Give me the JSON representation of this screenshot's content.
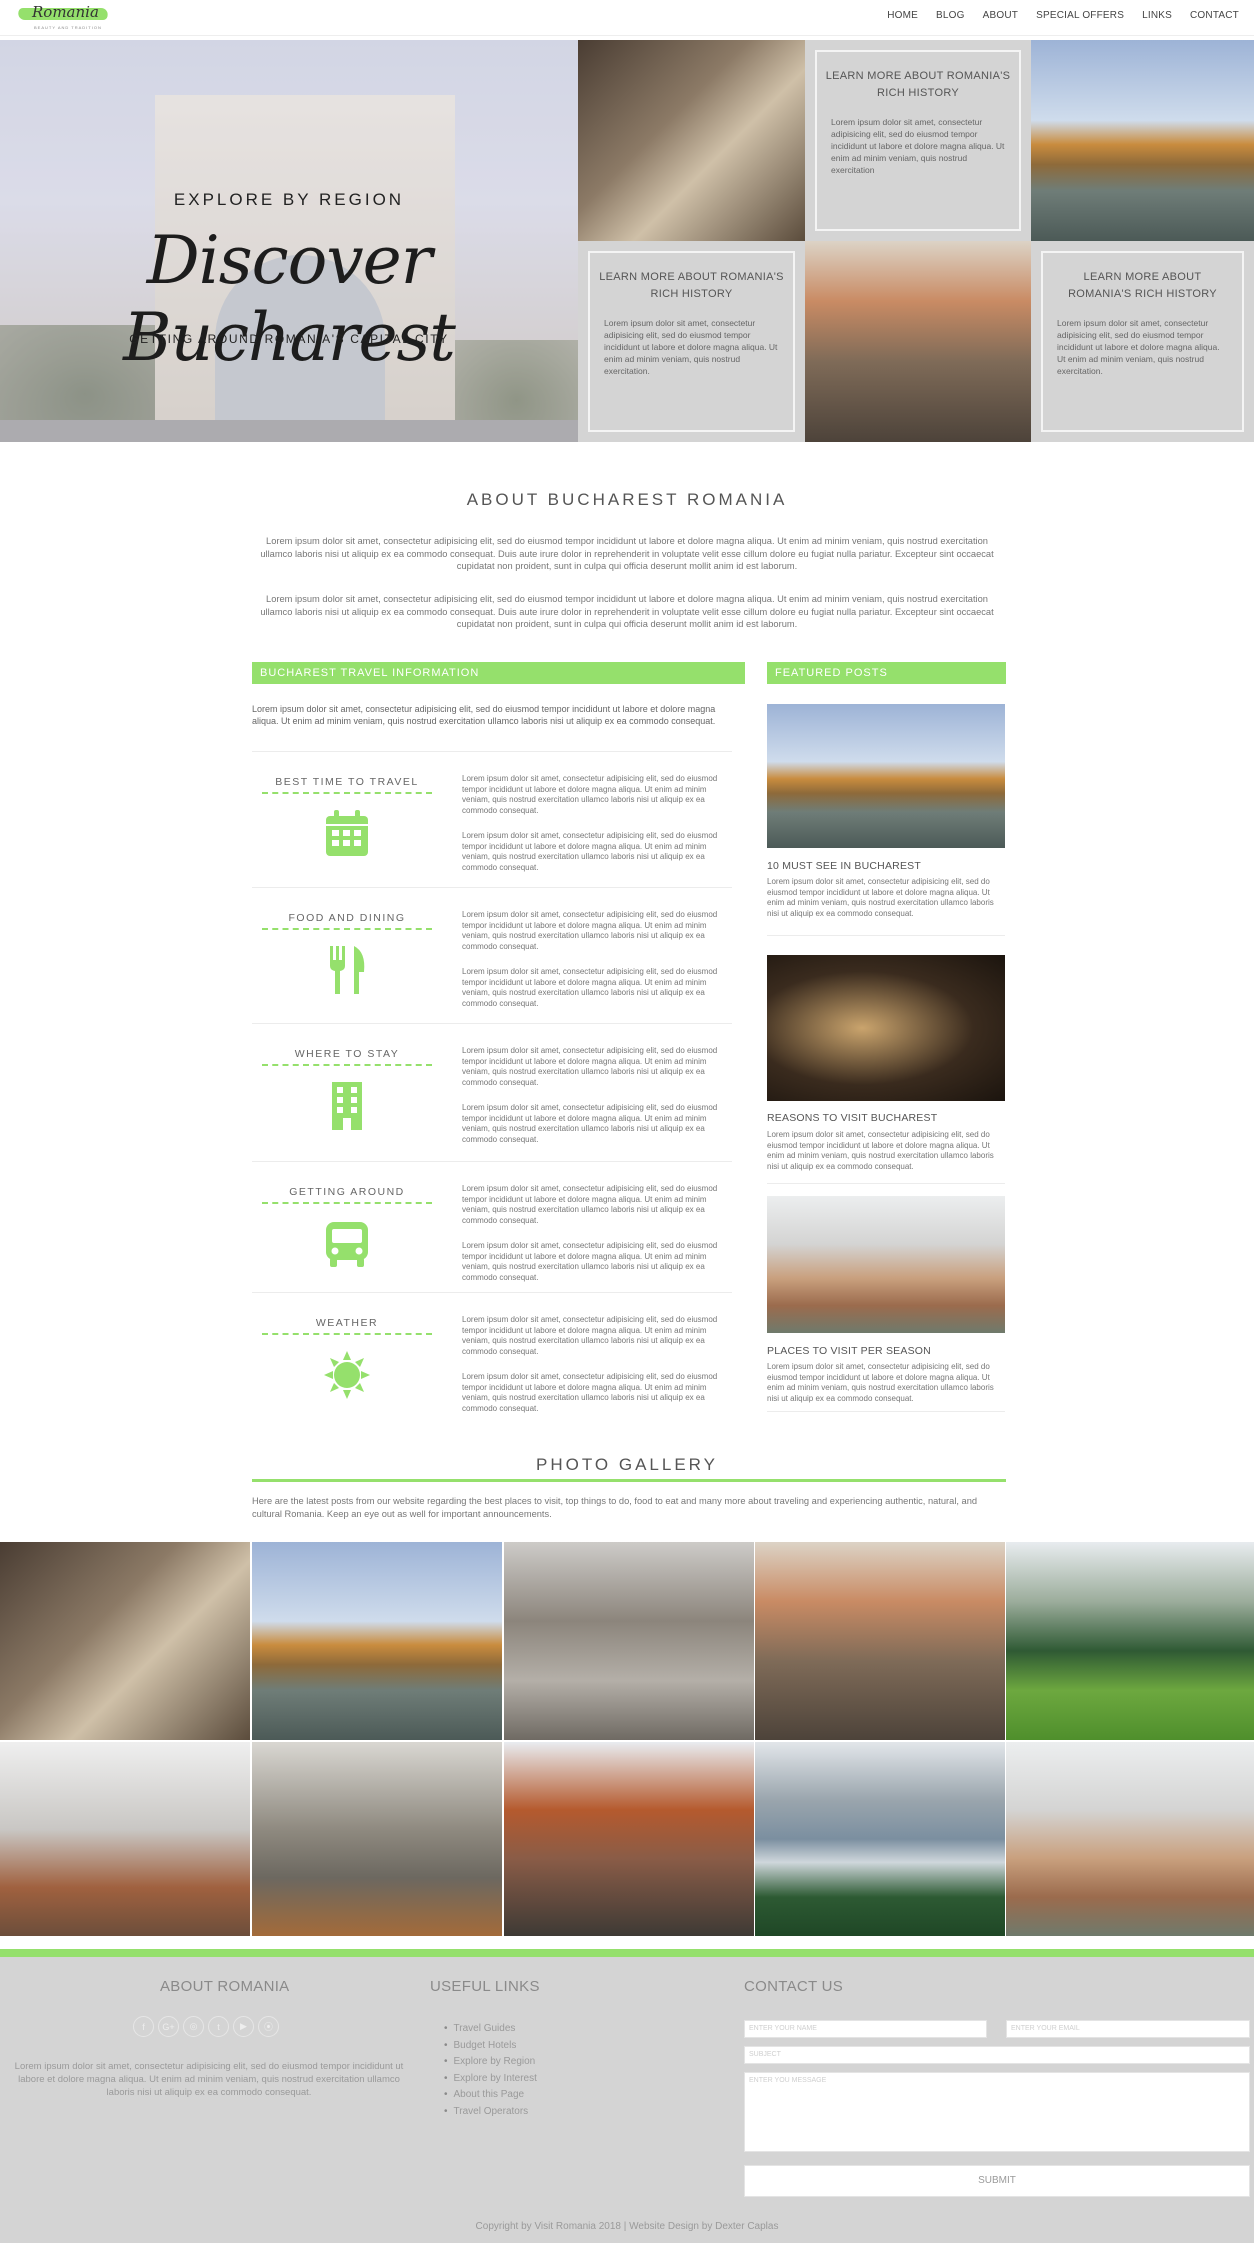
{
  "site": {
    "logo_text": "Romania",
    "logo_tagline": "BEAUTY AND TRADITION"
  },
  "nav": {
    "items": [
      "HOME",
      "BLOG",
      "ABOUT",
      "SPECIAL OFFERS",
      "LINKS",
      "CONTACT"
    ]
  },
  "hero": {
    "kicker": "EXPLORE BY REGION",
    "title": "Discover Bucharest",
    "subtitle": "GETTING AROUND ROMANIA'S CAPITAL CITY"
  },
  "mosaic": {
    "boxes": [
      {
        "title": "LEARN MORE ABOUT ROMANIA'S RICH HISTORY",
        "text": "Lorem ipsum dolor sit amet, consectetur adipisicing elit, sed do eiusmod tempor incididunt ut labore et dolore magna aliqua. Ut enim ad minim veniam, quis nostrud exercitation"
      },
      {
        "title": "LEARN MORE ABOUT ROMANIA'S RICH HISTORY",
        "text": "Lorem ipsum dolor sit amet, consectetur adipisicing elit, sed do eiusmod tempor incididunt ut labore et dolore magna aliqua. Ut enim ad minim veniam, quis nostrud exercitation."
      },
      {
        "title": "LEARN MORE ABOUT ROMANIA'S RICH HISTORY",
        "text": "Lorem ipsum dolor sit amet, consectetur adipisicing elit, sed do eiusmod tempor incididunt ut labore et dolore magna aliqua. Ut enim ad minim veniam, quis nostrud exercitation."
      }
    ]
  },
  "about": {
    "title": "ABOUT BUCHAREST ROMANIA",
    "paragraphs": [
      "Lorem ipsum dolor sit amet, consectetur adipisicing elit, sed do eiusmod tempor incididunt ut labore et dolore magna aliqua. Ut enim ad minim veniam, quis nostrud exercitation ullamco laboris nisi ut aliquip ex ea commodo consequat. Duis aute irure dolor in reprehenderit in voluptate velit esse cillum dolore eu fugiat nulla pariatur. Excepteur sint occaecat cupidatat non proident, sunt in culpa qui officia deserunt mollit anim id est laborum.",
      "Lorem ipsum dolor sit amet, consectetur adipisicing elit, sed do eiusmod tempor incididunt ut labore et dolore magna aliqua. Ut enim ad minim veniam, quis nostrud exercitation ullamco laboris nisi ut aliquip ex ea commodo consequat. Duis aute irure dolor in reprehenderit in voluptate velit esse cillum dolore eu fugiat nulla pariatur. Excepteur sint occaecat cupidatat non proident, sunt in culpa qui officia deserunt mollit anim id est laborum."
    ]
  },
  "travel": {
    "heading": "BUCHAREST TRAVEL INFORMATION",
    "intro": "Lorem ipsum dolor sit amet, consectetur adipisicing elit, sed do eiusmod tempor incididunt ut labore et dolore magna aliqua. Ut enim ad minim veniam, quis nostrud exercitation ullamco laboris nisi ut aliquip ex ea commodo consequat.",
    "row_text": "Lorem ipsum dolor sit amet, consectetur adipisicing elit, sed do eiusmod tempor incididunt ut labore et dolore magna aliqua. Ut enim ad minim veniam, quis nostrud exercitation ullamco laboris nisi ut aliquip ex ea commodo consequat.",
    "rows": [
      {
        "label": "BEST TIME TO TRAVEL",
        "icon": "calendar-icon"
      },
      {
        "label": "FOOD AND DINING",
        "icon": "fork-knife-icon"
      },
      {
        "label": "WHERE TO STAY",
        "icon": "building-icon"
      },
      {
        "label": "GETTING AROUND",
        "icon": "bus-icon"
      },
      {
        "label": "WEATHER",
        "icon": "sun-icon"
      }
    ]
  },
  "featured": {
    "heading": "FEATURED POSTS",
    "posts": [
      {
        "title": "10 MUST SEE IN BUCHAREST",
        "text": "Lorem ipsum dolor sit amet, consectetur adipisicing elit, sed do eiusmod tempor incididunt ut labore et dolore magna aliqua. Ut enim ad minim veniam, quis nostrud exercitation ullamco laboris nisi ut aliquip ex ea commodo consequat."
      },
      {
        "title": "REASONS TO VISIT BUCHAREST",
        "text": "Lorem ipsum dolor sit amet, consectetur adipisicing elit, sed do eiusmod tempor incididunt ut labore et dolore magna aliqua. Ut enim ad minim veniam, quis nostrud exercitation ullamco laboris nisi ut aliquip ex ea commodo consequat."
      },
      {
        "title": "PLACES TO VISIT PER SEASON",
        "text": "Lorem ipsum dolor sit amet, consectetur adipisicing elit, sed do eiusmod tempor incididunt ut labore et dolore magna aliqua. Ut enim ad minim veniam, quis nostrud exercitation ullamco laboris nisi ut aliquip ex ea commodo consequat."
      }
    ]
  },
  "gallery": {
    "title": "PHOTO GALLERY",
    "text": "Here are the latest posts from our website regarding the best places to visit, top things to do, food to eat and many more about traveling and experiencing authentic, natural, and cultural Romania. Keep an eye out as well for important announcements."
  },
  "footer": {
    "about_heading": "ABOUT ROMANIA",
    "about_text": "Lorem ipsum dolor sit amet, consectetur adipisicing elit, sed do eiusmod tempor incididunt ut labore et dolore magna aliqua. Ut enim ad minim veniam, quis nostrud exercitation ullamco laboris nisi ut aliquip ex ea commodo consequat.",
    "socials": [
      "f",
      "G+",
      "◎",
      "t",
      "▶",
      "⦿"
    ],
    "links_heading": "USEFUL LINKS",
    "links": [
      "Travel Guides",
      "Budget Hotels",
      "Explore by Region",
      "Explore by Interest",
      "About this Page",
      "Travel Operators"
    ],
    "contact_heading": "CONTACT US",
    "name_placeholder": "ENTER YOUR NAME",
    "email_placeholder": "ENTER YOUR EMAIL",
    "subject_placeholder": "SUBJECT",
    "message_placeholder": "ENTER YOU MESSAGE",
    "submit_label": "SUBMIT",
    "copyright": "Copyright by Visit Romania 2018 | Website Design by Dexter Caplas"
  },
  "colors": {
    "accent": "#95e06c",
    "box_gray": "#d4d4d4"
  }
}
